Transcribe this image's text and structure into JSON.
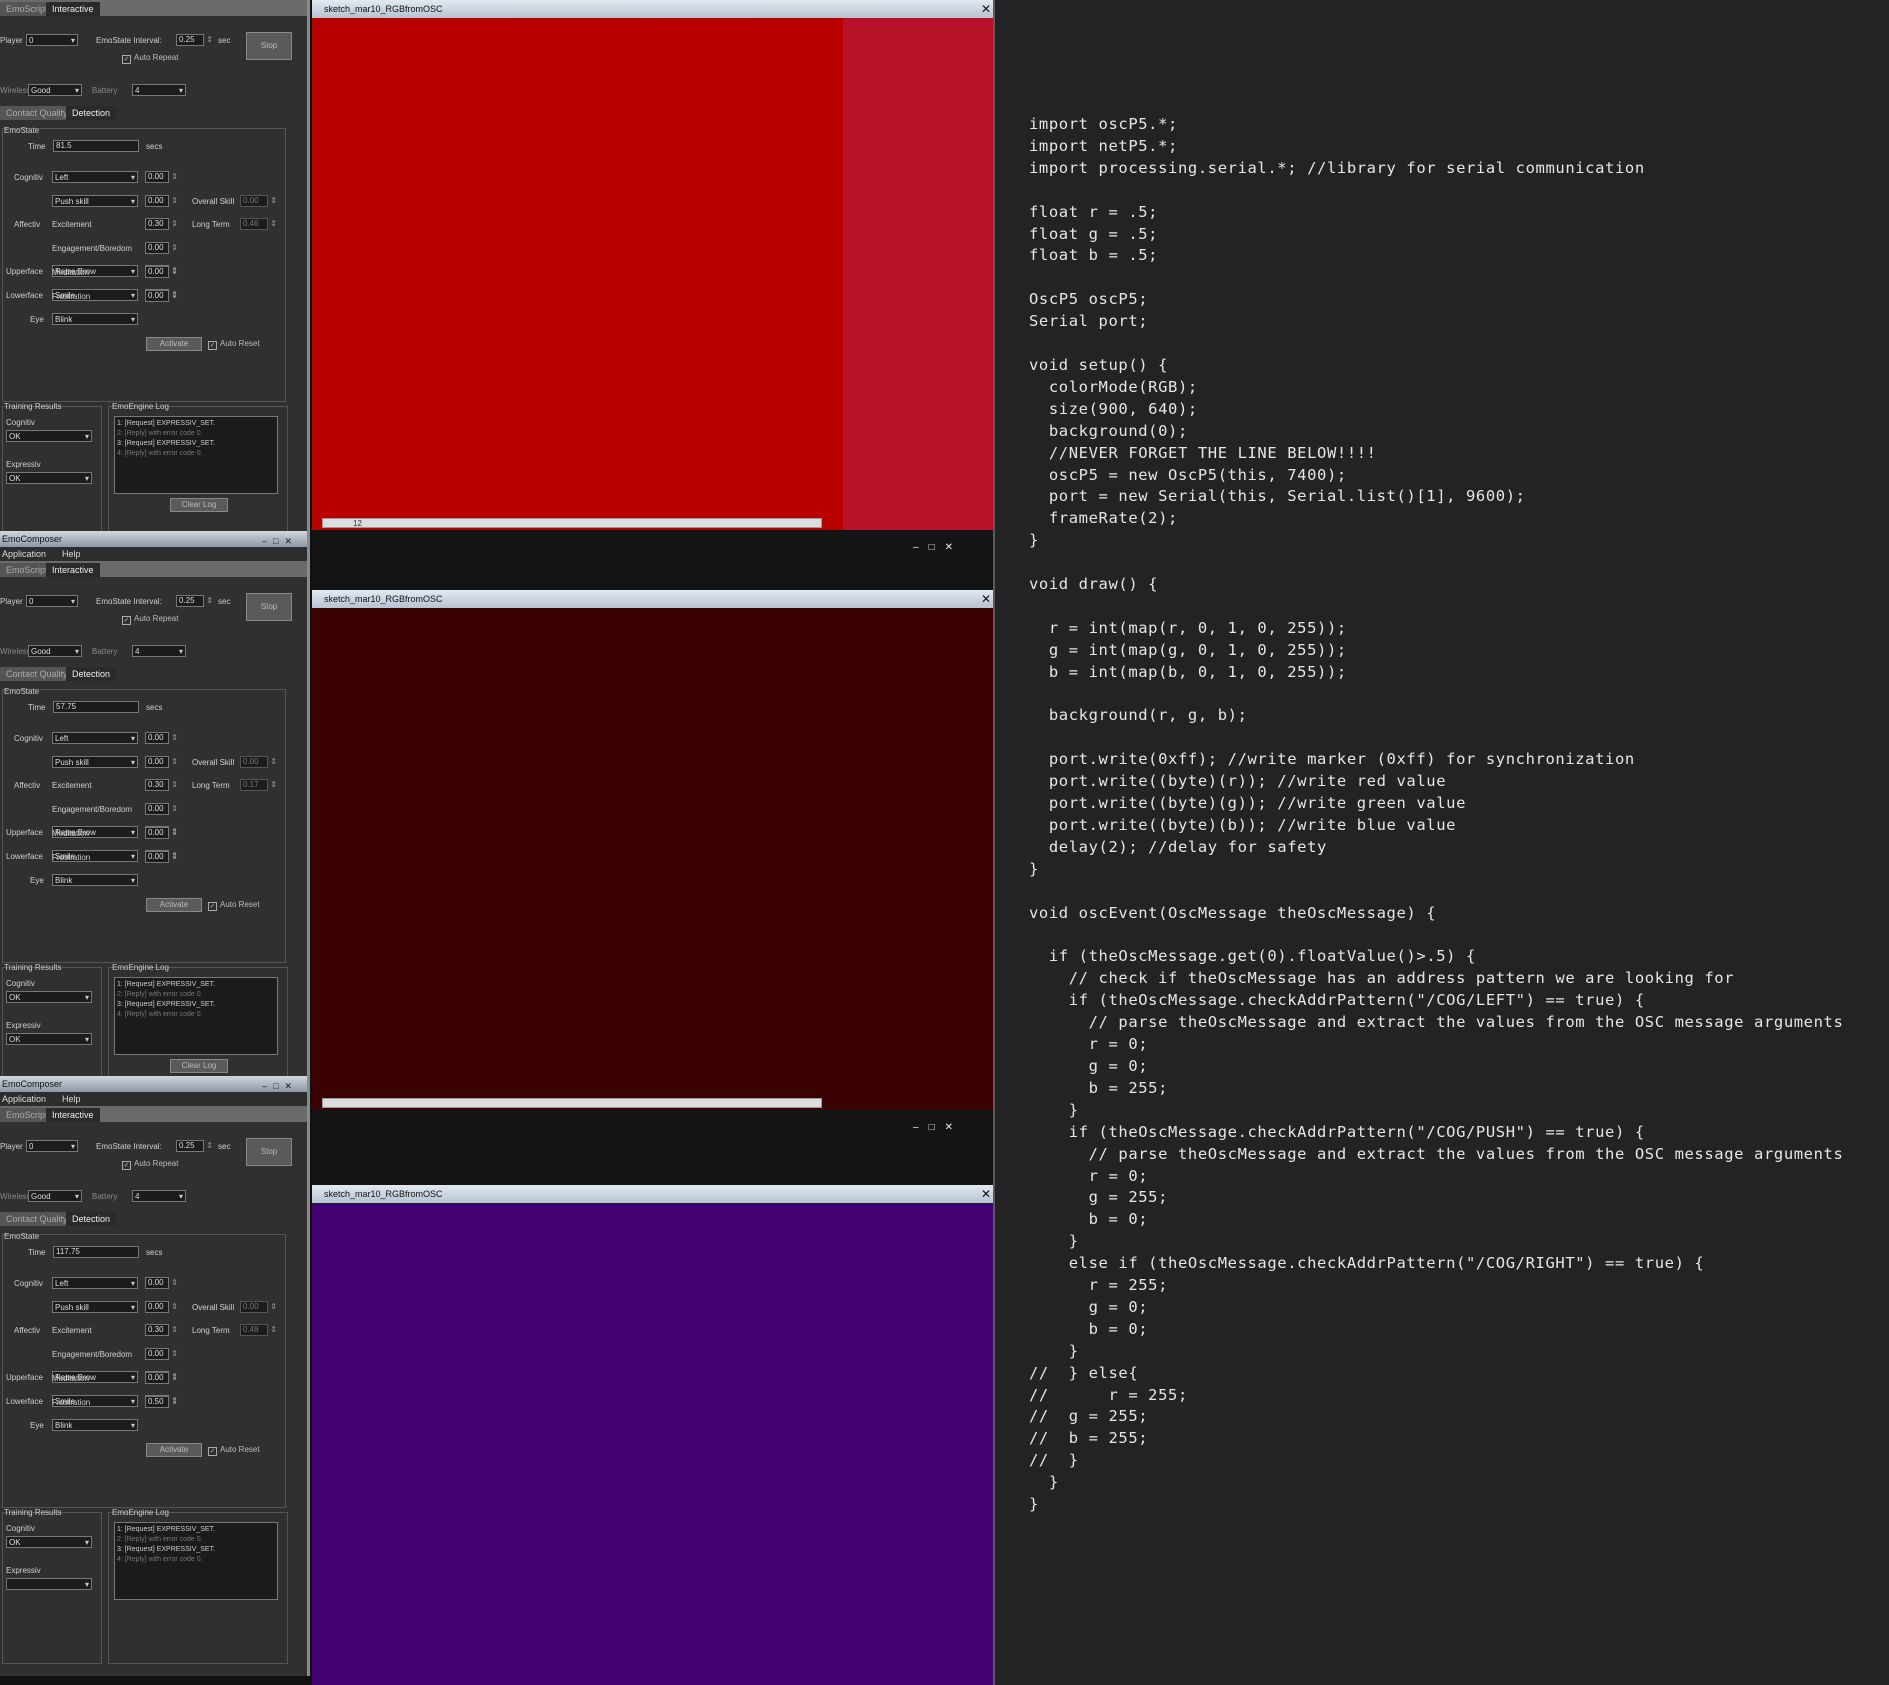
{
  "panels": [
    {
      "titlebar": "",
      "menus": [],
      "tabs": [
        "EmoScript",
        "Interactive"
      ],
      "player_label": "Player",
      "player_value": "0",
      "interval_label": "EmoState Interval:",
      "interval_value": "0.25",
      "interval_unit": "sec",
      "stop_label": "Stop",
      "auto_repeat": "Auto Repeat",
      "wireless_label": "Wireless",
      "wireless_value": "Good",
      "battery_label": "Battery",
      "battery_value": "4",
      "subtabs": [
        "Contact Quality",
        "Detection"
      ],
      "emostate_label": "EmoState",
      "time_label": "Time",
      "time_value": "81.5",
      "time_unit": "secs",
      "cognitiv_label": "Cognitiv",
      "cognitiv_action": "Left",
      "cognitiv_value": "0.00",
      "skill_action": "Push skill",
      "skill_value": "0.00",
      "overall_skill_label": "Overall Skill",
      "overall_skill_value": "0.00",
      "affectiv_label": "Affectiv",
      "excitement_label": "Excitement",
      "excitement_value": "0.30",
      "longterm_label": "Long Term",
      "longterm_value": "0.46",
      "engagement_label": "Engagement/Boredom",
      "engagement_value": "0.00",
      "meditation_label": "Meditation",
      "meditation_value": "0.00",
      "frustration_label": "Frustration",
      "frustration_value": "0.00",
      "upperface_label": "Upperface",
      "upperface_action": "Raise Brow",
      "upperface_value": "0.00",
      "lowerface_label": "Lowerface",
      "lowerface_action": "Smile",
      "lowerface_value": "0.00",
      "eye_label": "Eye",
      "eye_action": "Blink",
      "activate_label": "Activate",
      "auto_reset": "Auto Reset",
      "training_label": "Training Results",
      "training_cognitiv": "Cognitiv",
      "training_cognitiv_value": "OK",
      "training_expressiv": "Expressiv",
      "training_expressiv_value": "OK",
      "log_label": "EmoEngine Log",
      "log_lines": [
        "1: [Request] EXPRESSIV_SET.",
        "2: [Reply] with error code 0.",
        "3: [Request] EXPRESSIV_SET.",
        "4: [Reply] with error code 0."
      ],
      "clear_log": "Clear Log"
    },
    {
      "titlebar": "EmoComposer",
      "menus": [
        "Application",
        "Help"
      ],
      "tabs": [
        "EmoScript",
        "Interactive"
      ],
      "player_label": "Player",
      "player_value": "0",
      "interval_label": "EmoState Interval:",
      "interval_value": "0.25",
      "interval_unit": "sec",
      "stop_label": "Stop",
      "auto_repeat": "Auto Repeat",
      "wireless_label": "Wireless",
      "wireless_value": "Good",
      "battery_label": "Battery",
      "battery_value": "4",
      "subtabs": [
        "Contact Quality",
        "Detection"
      ],
      "emostate_label": "EmoState",
      "time_label": "Time",
      "time_value": "57.75",
      "time_unit": "secs",
      "cognitiv_label": "Cognitiv",
      "cognitiv_action": "Left",
      "cognitiv_value": "0.00",
      "skill_action": "Push skill",
      "skill_value": "0.00",
      "overall_skill_label": "Overall Skill",
      "overall_skill_value": "0.00",
      "affectiv_label": "Affectiv",
      "excitement_label": "Excitement",
      "excitement_value": "0.30",
      "longterm_label": "Long Term",
      "longterm_value": "0.17",
      "engagement_label": "Engagement/Boredom",
      "engagement_value": "0.00",
      "meditation_label": "Meditation",
      "meditation_value": "0.00",
      "frustration_label": "Frustration",
      "frustration_value": "0.00",
      "upperface_label": "Upperface",
      "upperface_action": "Raise Brow",
      "upperface_value": "0.00",
      "lowerface_label": "Lowerface",
      "lowerface_action": "Smile",
      "lowerface_value": "0.00",
      "eye_label": "Eye",
      "eye_action": "Blink",
      "activate_label": "Activate",
      "auto_reset": "Auto Reset",
      "training_label": "Training Results",
      "training_cognitiv": "Cognitiv",
      "training_cognitiv_value": "OK",
      "training_expressiv": "Expressiv",
      "training_expressiv_value": "OK",
      "log_label": "EmoEngine Log",
      "log_lines": [
        "1: [Request] EXPRESSIV_SET.",
        "2: [Reply] with error code 0.",
        "3: [Request] EXPRESSIV_SET.",
        "4: [Reply] with error code 0."
      ],
      "clear_log": "Clear Log"
    },
    {
      "titlebar": "EmoComposer",
      "menus": [
        "Application",
        "Help"
      ],
      "tabs": [
        "EmoScript",
        "Interactive"
      ],
      "player_label": "Player",
      "player_value": "0",
      "interval_label": "EmoState Interval:",
      "interval_value": "0.25",
      "interval_unit": "sec",
      "stop_label": "Stop",
      "auto_repeat": "Auto Repeat",
      "wireless_label": "Wireless",
      "wireless_value": "Good",
      "battery_label": "Battery",
      "battery_value": "4",
      "subtabs": [
        "Contact Quality",
        "Detection"
      ],
      "emostate_label": "EmoState",
      "time_label": "Time",
      "time_value": "117.75",
      "time_unit": "secs",
      "cognitiv_label": "Cognitiv",
      "cognitiv_action": "Left",
      "cognitiv_value": "0.00",
      "skill_action": "Push skill",
      "skill_value": "0.00",
      "overall_skill_label": "Overall Skill",
      "overall_skill_value": "0.00",
      "affectiv_label": "Affectiv",
      "excitement_label": "Excitement",
      "excitement_value": "0.30",
      "longterm_label": "Long Term",
      "longterm_value": "0.48",
      "engagement_label": "Engagement/Boredom",
      "engagement_value": "0.00",
      "meditation_label": "Meditation",
      "meditation_value": "0.00",
      "frustration_label": "Frustration",
      "frustration_value": "0.50",
      "upperface_label": "Upperface",
      "upperface_action": "Raise Brow",
      "upperface_value": "0.00",
      "lowerface_label": "Lowerface",
      "lowerface_action": "Smile",
      "lowerface_value": "0.00",
      "eye_label": "Eye",
      "eye_action": "Blink",
      "activate_label": "Activate",
      "auto_reset": "Auto Reset",
      "training_label": "Training Results",
      "training_cognitiv": "Cognitiv",
      "training_cognitiv_value": "OK",
      "training_expressiv": "Expressiv",
      "training_expressiv_value": "",
      "log_label": "EmoEngine Log",
      "log_lines": [
        "1: [Request] EXPRESSIV_SET.",
        "2: [Reply] with error code 0.",
        "3: [Request] EXPRESSIV_SET.",
        "4: [Reply] with error code 0."
      ],
      "clear_log": ""
    }
  ],
  "sketches": [
    {
      "title": "sketch_mar10_RGBfromOSC",
      "color": "#b80000",
      "edge_color": "#b8112a",
      "scroll_value": "12"
    },
    {
      "title": "sketch_mar10_RGBfromOSC",
      "color": "#3a0202",
      "edge_color": "#3a0202",
      "scroll_value": ""
    },
    {
      "title": "sketch_mar10_RGBfromOSC",
      "color": "#430070",
      "edge_color": "#430070",
      "scroll_value": ""
    }
  ],
  "code": {
    "lines": [
      "import oscP5.*;",
      "import netP5.*;",
      "import processing.serial.*; //library for serial communication",
      "",
      "float r = .5;",
      "float g = .5;",
      "float b = .5;",
      "",
      "OscP5 oscP5;",
      "Serial port;",
      "",
      "void setup() {",
      "  colorMode(RGB);",
      "  size(900, 640);",
      "  background(0);",
      "  //NEVER FORGET THE LINE BELOW!!!!",
      "  oscP5 = new OscP5(this, 7400);",
      "  port = new Serial(this, Serial.list()[1], 9600);",
      "  frameRate(2);",
      "}",
      "",
      "void draw() {",
      "",
      "  r = int(map(r, 0, 1, 0, 255));",
      "  g = int(map(g, 0, 1, 0, 255));",
      "  b = int(map(b, 0, 1, 0, 255));",
      "",
      "  background(r, g, b);",
      "",
      "  port.write(0xff); //write marker (0xff) for synchronization",
      "  port.write((byte)(r)); //write red value",
      "  port.write((byte)(g)); //write green value",
      "  port.write((byte)(b)); //write blue value",
      "  delay(2); //delay for safety",
      "}",
      "",
      "void oscEvent(OscMessage theOscMessage) {",
      "",
      "  if (theOscMessage.get(0).floatValue()>.5) {",
      "    // check if theOscMessage has an address pattern we are looking for",
      "    if (theOscMessage.checkAddrPattern(\"/COG/LEFT\") == true) {",
      "      // parse theOscMessage and extract the values from the OSC message arguments",
      "      r = 0;",
      "      g = 0;",
      "      b = 255;",
      "    }",
      "    if (theOscMessage.checkAddrPattern(\"/COG/PUSH\") == true) {",
      "      // parse theOscMessage and extract the values from the OSC message arguments",
      "      r = 0;",
      "      g = 255;",
      "      b = 0;",
      "    }",
      "    else if (theOscMessage.checkAddrPattern(\"/COG/RIGHT\") == true) {",
      "      r = 255;",
      "      g = 0;",
      "      b = 0;",
      "    }",
      "//  } else{",
      "//      r = 255;",
      "//  g = 255;",
      "//  b = 255;",
      "//  }",
      "  }",
      "}"
    ]
  }
}
